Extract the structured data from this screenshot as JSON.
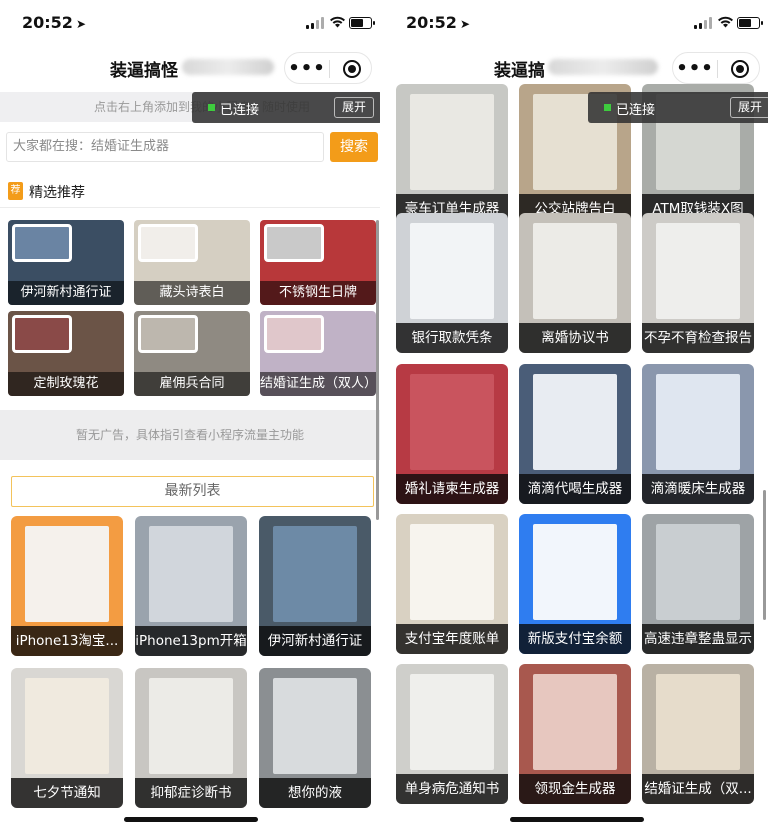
{
  "status": {
    "time": "20:52"
  },
  "left": {
    "nav_title": "装逼搞怪",
    "hint": "点击右上角添加到我的小程序，随时使用",
    "connected": {
      "label": "已连接",
      "expand": "展开"
    },
    "search": {
      "placeholder": "大家都在搜：结婚证生成器",
      "button": "搜索"
    },
    "section": {
      "tag": "荐",
      "title": "精选推荐"
    },
    "featured": [
      {
        "label": "伊河新村通行证",
        "bg": "#3b4e63",
        "thumb": "#6a84a3"
      },
      {
        "label": "藏头诗表白",
        "bg": "#d5cfc2",
        "thumb": "#f1eeea"
      },
      {
        "label": "不锈钢生日牌",
        "bg": "#b8383a",
        "thumb": "#c9c9c9"
      },
      {
        "label": "定制玫瑰花",
        "bg": "#6b5447",
        "thumb": "#8a4a48"
      },
      {
        "label": "雇佣兵合同",
        "bg": "#8f8a82",
        "thumb": "#bdb7ae"
      },
      {
        "label": "结婚证生成（双人）",
        "bg": "#c0b2c6",
        "thumb": "#e0c7cb"
      }
    ],
    "ad": "暂无广告，具体指引查看小程序流量主功能",
    "latest": "最新列表",
    "cards": [
      {
        "label": "iPhone13淘宝...",
        "bg": "#f39c42",
        "img": "#f5f1ec"
      },
      {
        "label": "iPhone13pm开箱",
        "bg": "#9aa3ad",
        "img": "#d1d6dc"
      },
      {
        "label": "伊河新村通行证",
        "bg": "#4a5a68",
        "img": "#6d8aa6"
      },
      {
        "label": "七夕节通知",
        "bg": "#d9d7d3",
        "img": "#f0eadf"
      },
      {
        "label": "抑郁症诊断书",
        "bg": "#c8c6c2",
        "img": "#ecebe7"
      },
      {
        "label": "想你的液",
        "bg": "#8b8f92",
        "img": "#d8dbdd"
      }
    ]
  },
  "right": {
    "nav_title": "装逼搞",
    "connected": {
      "label": "已连接",
      "expand": "展开"
    },
    "cards": [
      {
        "label": "豪车订单生成器",
        "bg": "#c7c8c4",
        "img": "#e9e8e3"
      },
      {
        "label": "公交站牌告白",
        "bg": "#b8a58a",
        "img": "#e6e0d2"
      },
      {
        "label": "ATM取钱装X图",
        "bg": "#a9aca8",
        "img": "#d5d7d2"
      },
      {
        "label": "银行取款凭条",
        "bg": "#cfd2d6",
        "img": "#f2f4f6"
      },
      {
        "label": "离婚协议书",
        "bg": "#c4c0b9",
        "img": "#ecebe7"
      },
      {
        "label": "不孕不育检查报告",
        "bg": "#cdcbc7",
        "img": "#eeeeec"
      },
      {
        "label": "婚礼请柬生成器",
        "bg": "#b73a44",
        "img": "#c9545e"
      },
      {
        "label": "滴滴代喝生成器",
        "bg": "#4a5d78",
        "img": "#e8ecf2"
      },
      {
        "label": "滴滴暖床生成器",
        "bg": "#8a97ad",
        "img": "#dfe6f0"
      },
      {
        "label": "支付宝年度账单",
        "bg": "#d9d1c2",
        "img": "#f7f4ee"
      },
      {
        "label": "新版支付宝余额",
        "bg": "#2f7df0",
        "img": "#f2f6fc"
      },
      {
        "label": "高速违章整蛊显示",
        "bg": "#9ea3a6",
        "img": "#c9ced1"
      },
      {
        "label": "单身病危通知书",
        "bg": "#cfcfcb",
        "img": "#efefec"
      },
      {
        "label": "领现金生成器",
        "bg": "#a8584e",
        "img": "#e7c7bf"
      },
      {
        "label": "结婚证生成（双...",
        "bg": "#b9b1a4",
        "img": "#e6dccb"
      }
    ]
  }
}
